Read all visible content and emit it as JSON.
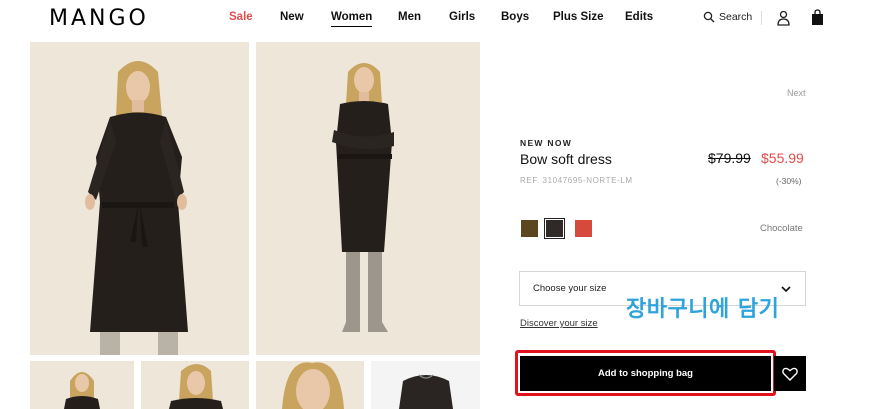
{
  "header": {
    "logo": "MANGO",
    "nav": [
      {
        "label": "Sale",
        "key": "sale"
      },
      {
        "label": "New",
        "key": "new"
      },
      {
        "label": "Women",
        "key": "women"
      },
      {
        "label": "Men",
        "key": "men"
      },
      {
        "label": "Girls",
        "key": "girls"
      },
      {
        "label": "Boys",
        "key": "boys"
      },
      {
        "label": "Plus Size",
        "key": "plus-size"
      },
      {
        "label": "Edits",
        "key": "edits"
      }
    ],
    "active_nav": "Women",
    "search_label": "Search",
    "icons": {
      "search": "search-icon",
      "user": "user-icon",
      "bag": "shopping-bag-icon"
    }
  },
  "gallery": {
    "images": [
      "model-front",
      "model-side"
    ],
    "thumbnails": [
      "model-front-thumb",
      "model-detail-thumb",
      "model-face-thumb",
      "dress-flat-thumb"
    ]
  },
  "product": {
    "next_label": "Next",
    "badge": "NEW NOW",
    "name": "Bow soft dress",
    "old_price": "$79.99",
    "price": "$55.99",
    "reference": "REF. 31047695-NORTE-LM",
    "discount": "(-30%)",
    "colors": [
      {
        "name": "Olive brown",
        "hex": "#5c4620"
      },
      {
        "name": "Chocolate",
        "hex": "#2f2a27",
        "selected": true
      },
      {
        "name": "Red",
        "hex": "#d64a3d"
      }
    ],
    "selected_color": "Chocolate",
    "size_placeholder": "Choose your size",
    "discover_size": "Discover your size",
    "add_to_bag": "Add to shopping bag"
  },
  "annotation": {
    "text": "장바구니에 담기",
    "color": "#2fa3dc",
    "box_color": "#e0121c"
  },
  "colors": {
    "sale": "#e34b4b",
    "price": "#e34b4b",
    "photo_bg": "#ece5d8"
  }
}
